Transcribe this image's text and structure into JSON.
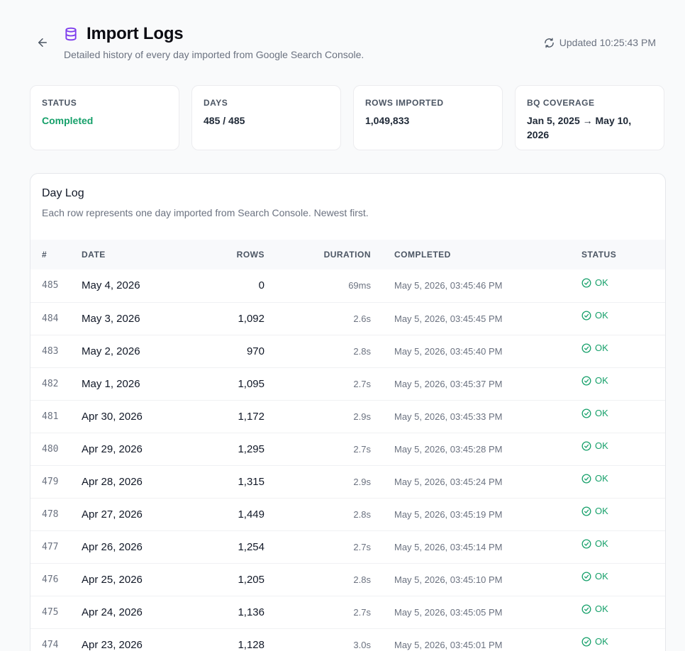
{
  "header": {
    "title": "Import Logs",
    "subtitle": "Detailed history of every day imported from Google Search Console.",
    "updated": "Updated 10:25:43 PM"
  },
  "stats": [
    {
      "label": "STATUS",
      "value": "Completed"
    },
    {
      "label": "DAYS",
      "value": "485 / 485"
    },
    {
      "label": "ROWS IMPORTED",
      "value": "1,049,833"
    },
    {
      "label": "BQ COVERAGE",
      "value": "Jan 5, 2025 → May 10, 2026"
    }
  ],
  "day_log": {
    "title": "Day Log",
    "description": "Each row represents one day imported from Search Console. Newest first.",
    "columns": {
      "num": "#",
      "date": "DATE",
      "rows": "ROWS",
      "duration": "DURATION",
      "completed": "COMPLETED",
      "status": "STATUS"
    },
    "rows": [
      {
        "num": "485",
        "date": "May 4, 2026",
        "rows": "0",
        "duration": "69ms",
        "completed": "May 5, 2026, 03:45:46 PM",
        "status": "OK"
      },
      {
        "num": "484",
        "date": "May 3, 2026",
        "rows": "1,092",
        "duration": "2.6s",
        "completed": "May 5, 2026, 03:45:45 PM",
        "status": "OK"
      },
      {
        "num": "483",
        "date": "May 2, 2026",
        "rows": "970",
        "duration": "2.8s",
        "completed": "May 5, 2026, 03:45:40 PM",
        "status": "OK"
      },
      {
        "num": "482",
        "date": "May 1, 2026",
        "rows": "1,095",
        "duration": "2.7s",
        "completed": "May 5, 2026, 03:45:37 PM",
        "status": "OK"
      },
      {
        "num": "481",
        "date": "Apr 30, 2026",
        "rows": "1,172",
        "duration": "2.9s",
        "completed": "May 5, 2026, 03:45:33 PM",
        "status": "OK"
      },
      {
        "num": "480",
        "date": "Apr 29, 2026",
        "rows": "1,295",
        "duration": "2.7s",
        "completed": "May 5, 2026, 03:45:28 PM",
        "status": "OK"
      },
      {
        "num": "479",
        "date": "Apr 28, 2026",
        "rows": "1,315",
        "duration": "2.9s",
        "completed": "May 5, 2026, 03:45:24 PM",
        "status": "OK"
      },
      {
        "num": "478",
        "date": "Apr 27, 2026",
        "rows": "1,449",
        "duration": "2.8s",
        "completed": "May 5, 2026, 03:45:19 PM",
        "status": "OK"
      },
      {
        "num": "477",
        "date": "Apr 26, 2026",
        "rows": "1,254",
        "duration": "2.7s",
        "completed": "May 5, 2026, 03:45:14 PM",
        "status": "OK"
      },
      {
        "num": "476",
        "date": "Apr 25, 2026",
        "rows": "1,205",
        "duration": "2.8s",
        "completed": "May 5, 2026, 03:45:10 PM",
        "status": "OK"
      },
      {
        "num": "475",
        "date": "Apr 24, 2026",
        "rows": "1,136",
        "duration": "2.7s",
        "completed": "May 5, 2026, 03:45:05 PM",
        "status": "OK"
      },
      {
        "num": "474",
        "date": "Apr 23, 2026",
        "rows": "1,128",
        "duration": "3.0s",
        "completed": "May 5, 2026, 03:45:01 PM",
        "status": "OK"
      }
    ]
  },
  "colors": {
    "accent": "#7c3aed",
    "success": "#16a06a",
    "background": "#f9fafb"
  },
  "icons": {
    "back": "arrow-left-icon",
    "title": "database-icon",
    "refresh": "refresh-icon",
    "status_ok": "check-circle-icon"
  }
}
